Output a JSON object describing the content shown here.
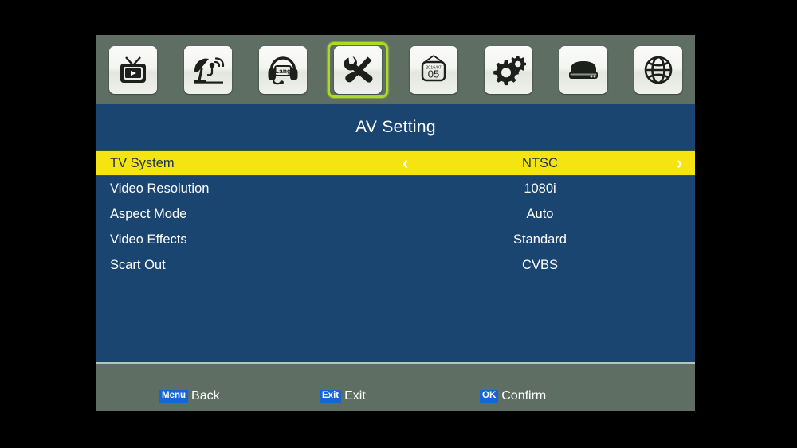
{
  "icon_bar": {
    "items": [
      {
        "name": "tv-program-icon",
        "label": "Program",
        "selected": false
      },
      {
        "name": "satellite-icon",
        "label": "Installation",
        "selected": false
      },
      {
        "name": "headphones-lang-icon",
        "label": "Lang",
        "selected": false,
        "inner_text": "Lang"
      },
      {
        "name": "tools-icon",
        "label": "AV Setting",
        "selected": true
      },
      {
        "name": "calendar-icon",
        "label": "Timer",
        "selected": false,
        "date_top": "2016/07",
        "date_day": "05"
      },
      {
        "name": "gears-icon",
        "label": "System",
        "selected": false
      },
      {
        "name": "hdd-icon",
        "label": "USB",
        "selected": false
      },
      {
        "name": "globe-icon",
        "label": "Network",
        "selected": false
      }
    ],
    "selected_index": 3
  },
  "title": "AV Setting",
  "menu": {
    "rows": [
      {
        "label": "TV System",
        "value": "NTSC",
        "selected": true
      },
      {
        "label": "Video Resolution",
        "value": "1080i",
        "selected": false
      },
      {
        "label": "Aspect Mode",
        "value": "Auto",
        "selected": false
      },
      {
        "label": "Video Effects",
        "value": "Standard",
        "selected": false
      },
      {
        "label": "Scart Out",
        "value": "CVBS",
        "selected": false
      }
    ],
    "arrow_left": "‹",
    "arrow_right": "›"
  },
  "footer": {
    "hints": [
      {
        "key": "Menu",
        "action": "Back"
      },
      {
        "key": "Exit",
        "action": "Exit"
      },
      {
        "key": "OK",
        "action": "Confirm"
      }
    ]
  },
  "colors": {
    "panel_blue": "#1a4571",
    "bar_gray_green": "#5f6e63",
    "highlight_yellow": "#f5e312",
    "selection_green": "#aadd22",
    "key_badge_blue": "#1565d8",
    "text_white": "#ffffff",
    "highlight_text": "#16324f",
    "backdrop_black": "#000000"
  }
}
